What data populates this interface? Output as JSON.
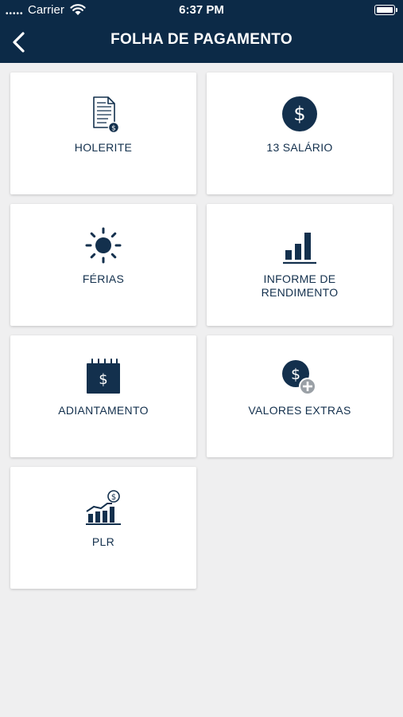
{
  "status_bar": {
    "carrier": "Carrier",
    "time": "6:37 PM"
  },
  "header": {
    "title": "FOLHA DE PAGAMENTO"
  },
  "menu": {
    "items": [
      {
        "label": "HOLERITE",
        "icon": "payslip-document-icon"
      },
      {
        "label": "13 SALÁRIO",
        "icon": "dollar-circle-icon"
      },
      {
        "label": "FÉRIAS",
        "icon": "sun-icon"
      },
      {
        "label": "INFORME DE RENDIMENTO",
        "icon": "bar-chart-icon"
      },
      {
        "label": "ADIANTAMENTO",
        "icon": "calendar-dollar-icon"
      },
      {
        "label": "VALORES EXTRAS",
        "icon": "dollar-plus-icon"
      },
      {
        "label": "PLR",
        "icon": "growth-chart-dollar-icon"
      }
    ]
  },
  "colors": {
    "header": "#0c2a47",
    "icon": "#0f2b48",
    "background": "#efeff0"
  }
}
